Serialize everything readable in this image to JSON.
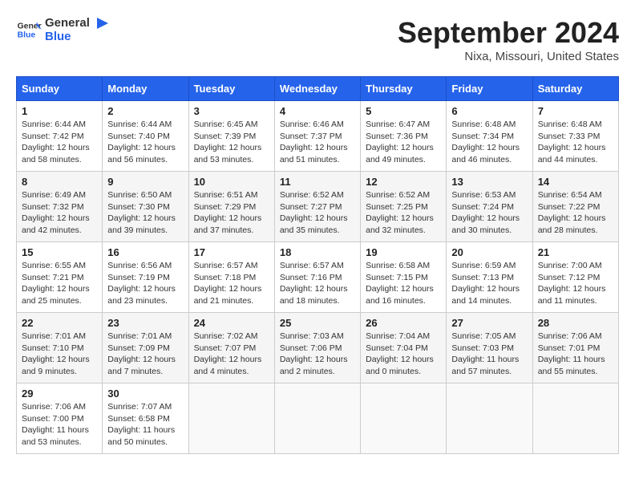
{
  "header": {
    "logo_general": "General",
    "logo_blue": "Blue",
    "title": "September 2024",
    "location": "Nixa, Missouri, United States"
  },
  "columns": [
    "Sunday",
    "Monday",
    "Tuesday",
    "Wednesday",
    "Thursday",
    "Friday",
    "Saturday"
  ],
  "weeks": [
    [
      {
        "day": "1",
        "sunrise": "Sunrise: 6:44 AM",
        "sunset": "Sunset: 7:42 PM",
        "daylight": "Daylight: 12 hours and 58 minutes."
      },
      {
        "day": "2",
        "sunrise": "Sunrise: 6:44 AM",
        "sunset": "Sunset: 7:40 PM",
        "daylight": "Daylight: 12 hours and 56 minutes."
      },
      {
        "day": "3",
        "sunrise": "Sunrise: 6:45 AM",
        "sunset": "Sunset: 7:39 PM",
        "daylight": "Daylight: 12 hours and 53 minutes."
      },
      {
        "day": "4",
        "sunrise": "Sunrise: 6:46 AM",
        "sunset": "Sunset: 7:37 PM",
        "daylight": "Daylight: 12 hours and 51 minutes."
      },
      {
        "day": "5",
        "sunrise": "Sunrise: 6:47 AM",
        "sunset": "Sunset: 7:36 PM",
        "daylight": "Daylight: 12 hours and 49 minutes."
      },
      {
        "day": "6",
        "sunrise": "Sunrise: 6:48 AM",
        "sunset": "Sunset: 7:34 PM",
        "daylight": "Daylight: 12 hours and 46 minutes."
      },
      {
        "day": "7",
        "sunrise": "Sunrise: 6:48 AM",
        "sunset": "Sunset: 7:33 PM",
        "daylight": "Daylight: 12 hours and 44 minutes."
      }
    ],
    [
      {
        "day": "8",
        "sunrise": "Sunrise: 6:49 AM",
        "sunset": "Sunset: 7:32 PM",
        "daylight": "Daylight: 12 hours and 42 minutes."
      },
      {
        "day": "9",
        "sunrise": "Sunrise: 6:50 AM",
        "sunset": "Sunset: 7:30 PM",
        "daylight": "Daylight: 12 hours and 39 minutes."
      },
      {
        "day": "10",
        "sunrise": "Sunrise: 6:51 AM",
        "sunset": "Sunset: 7:29 PM",
        "daylight": "Daylight: 12 hours and 37 minutes."
      },
      {
        "day": "11",
        "sunrise": "Sunrise: 6:52 AM",
        "sunset": "Sunset: 7:27 PM",
        "daylight": "Daylight: 12 hours and 35 minutes."
      },
      {
        "day": "12",
        "sunrise": "Sunrise: 6:52 AM",
        "sunset": "Sunset: 7:25 PM",
        "daylight": "Daylight: 12 hours and 32 minutes."
      },
      {
        "day": "13",
        "sunrise": "Sunrise: 6:53 AM",
        "sunset": "Sunset: 7:24 PM",
        "daylight": "Daylight: 12 hours and 30 minutes."
      },
      {
        "day": "14",
        "sunrise": "Sunrise: 6:54 AM",
        "sunset": "Sunset: 7:22 PM",
        "daylight": "Daylight: 12 hours and 28 minutes."
      }
    ],
    [
      {
        "day": "15",
        "sunrise": "Sunrise: 6:55 AM",
        "sunset": "Sunset: 7:21 PM",
        "daylight": "Daylight: 12 hours and 25 minutes."
      },
      {
        "day": "16",
        "sunrise": "Sunrise: 6:56 AM",
        "sunset": "Sunset: 7:19 PM",
        "daylight": "Daylight: 12 hours and 23 minutes."
      },
      {
        "day": "17",
        "sunrise": "Sunrise: 6:57 AM",
        "sunset": "Sunset: 7:18 PM",
        "daylight": "Daylight: 12 hours and 21 minutes."
      },
      {
        "day": "18",
        "sunrise": "Sunrise: 6:57 AM",
        "sunset": "Sunset: 7:16 PM",
        "daylight": "Daylight: 12 hours and 18 minutes."
      },
      {
        "day": "19",
        "sunrise": "Sunrise: 6:58 AM",
        "sunset": "Sunset: 7:15 PM",
        "daylight": "Daylight: 12 hours and 16 minutes."
      },
      {
        "day": "20",
        "sunrise": "Sunrise: 6:59 AM",
        "sunset": "Sunset: 7:13 PM",
        "daylight": "Daylight: 12 hours and 14 minutes."
      },
      {
        "day": "21",
        "sunrise": "Sunrise: 7:00 AM",
        "sunset": "Sunset: 7:12 PM",
        "daylight": "Daylight: 12 hours and 11 minutes."
      }
    ],
    [
      {
        "day": "22",
        "sunrise": "Sunrise: 7:01 AM",
        "sunset": "Sunset: 7:10 PM",
        "daylight": "Daylight: 12 hours and 9 minutes."
      },
      {
        "day": "23",
        "sunrise": "Sunrise: 7:01 AM",
        "sunset": "Sunset: 7:09 PM",
        "daylight": "Daylight: 12 hours and 7 minutes."
      },
      {
        "day": "24",
        "sunrise": "Sunrise: 7:02 AM",
        "sunset": "Sunset: 7:07 PM",
        "daylight": "Daylight: 12 hours and 4 minutes."
      },
      {
        "day": "25",
        "sunrise": "Sunrise: 7:03 AM",
        "sunset": "Sunset: 7:06 PM",
        "daylight": "Daylight: 12 hours and 2 minutes."
      },
      {
        "day": "26",
        "sunrise": "Sunrise: 7:04 AM",
        "sunset": "Sunset: 7:04 PM",
        "daylight": "Daylight: 12 hours and 0 minutes."
      },
      {
        "day": "27",
        "sunrise": "Sunrise: 7:05 AM",
        "sunset": "Sunset: 7:03 PM",
        "daylight": "Daylight: 11 hours and 57 minutes."
      },
      {
        "day": "28",
        "sunrise": "Sunrise: 7:06 AM",
        "sunset": "Sunset: 7:01 PM",
        "daylight": "Daylight: 11 hours and 55 minutes."
      }
    ],
    [
      {
        "day": "29",
        "sunrise": "Sunrise: 7:06 AM",
        "sunset": "Sunset: 7:00 PM",
        "daylight": "Daylight: 11 hours and 53 minutes."
      },
      {
        "day": "30",
        "sunrise": "Sunrise: 7:07 AM",
        "sunset": "Sunset: 6:58 PM",
        "daylight": "Daylight: 11 hours and 50 minutes."
      },
      null,
      null,
      null,
      null,
      null
    ]
  ]
}
